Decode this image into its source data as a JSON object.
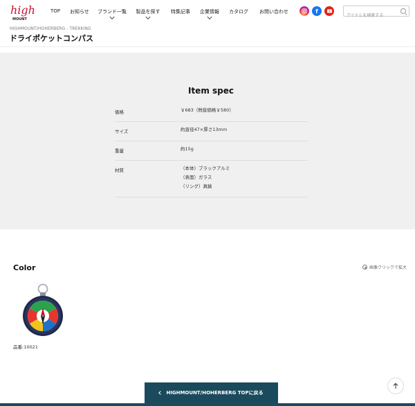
{
  "header": {
    "logo_text": "High MOUNT",
    "nav": [
      {
        "label": "TOP",
        "has_submenu": false
      },
      {
        "label": "お知らせ",
        "has_submenu": false
      },
      {
        "label": "ブランド一覧",
        "has_submenu": true
      },
      {
        "label": "製品を探す",
        "has_submenu": true
      },
      {
        "label": "特集記事",
        "has_submenu": false
      },
      {
        "label": "企業情報",
        "has_submenu": true
      },
      {
        "label": "カタログ",
        "has_submenu": false
      },
      {
        "label": "お問い合わせ",
        "has_submenu": false
      }
    ],
    "social": {
      "instagram": "instagram-icon",
      "facebook": "f",
      "youtube": "youtube-icon"
    },
    "search_placeholder": "アイテムを検索する"
  },
  "breadcrumb": "HIGHMOUNT/HOHERBERG - TREKKING",
  "page_title": "ドライポケットコンパス",
  "spec": {
    "title": "Item spec",
    "rows": [
      {
        "label": "価格",
        "lines": [
          "￥683（税抜価格￥580）"
        ]
      },
      {
        "label": "サイズ",
        "lines": [
          "約直径47×厚さ13mm"
        ]
      },
      {
        "label": "重量",
        "lines": [
          "約15g"
        ]
      },
      {
        "label": "材質",
        "lines": [
          "（本体）ブラックアルミ",
          "（表面）ガラス",
          "（リング）真鍮"
        ]
      }
    ]
  },
  "color": {
    "title": "Color",
    "zoom_hint": "画像クリックで拡大",
    "items": [
      {
        "sku": "品番:10021"
      }
    ]
  },
  "back_button": "HIGHMOUNT/HOHERBERG TOPに戻る",
  "colors": {
    "accent": "#1b4a5c",
    "spec_bg": "#f0f0f0",
    "logo_red": "#c8102e"
  }
}
